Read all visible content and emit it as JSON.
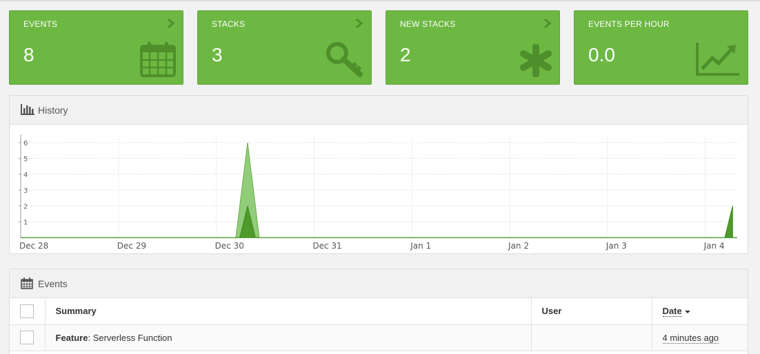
{
  "tiles": [
    {
      "label": "EVENTS",
      "value": "8",
      "icon": "calendar-icon"
    },
    {
      "label": "STACKS",
      "value": "3",
      "icon": "key-icon"
    },
    {
      "label": "NEW STACKS",
      "value": "2",
      "icon": "asterisk-icon"
    },
    {
      "label": "EVENTS PER HOUR",
      "value": "0.0",
      "icon": "trend-chart-icon"
    }
  ],
  "colors": {
    "tile": "#6db843",
    "tile_icon": "#4f8f2b",
    "series_light": "#7fc464",
    "series_dark": "#4e9a2a"
  },
  "history": {
    "title": "History"
  },
  "chart_data": {
    "type": "area",
    "x": [
      "Dec 28",
      "Dec 29",
      "Dec 30",
      "Dec 31",
      "Jan 1",
      "Jan 2",
      "Jan 3",
      "Jan 4"
    ],
    "ylim": [
      0,
      6
    ],
    "yticks": [
      "1",
      "2",
      "3",
      "4",
      "5",
      "6"
    ],
    "grid": true,
    "series": [
      {
        "points": [
          [
            2.2,
            0
          ],
          [
            2.32,
            6
          ],
          [
            2.44,
            0
          ],
          [
            7.2,
            0
          ],
          [
            7.25,
            0
          ]
        ]
      },
      {
        "points": [
          [
            2.24,
            0
          ],
          [
            2.32,
            2
          ],
          [
            2.4,
            0
          ],
          [
            7.2,
            0
          ],
          [
            7.28,
            2
          ]
        ]
      }
    ]
  },
  "events": {
    "title": "Events",
    "columns": {
      "summary": "Summary",
      "user": "User",
      "date": "Date"
    },
    "rows": [
      {
        "type": "Feature",
        "sep": ": ",
        "summary": "Serverless Function",
        "user": "",
        "date": "4 minutes ago"
      }
    ]
  }
}
